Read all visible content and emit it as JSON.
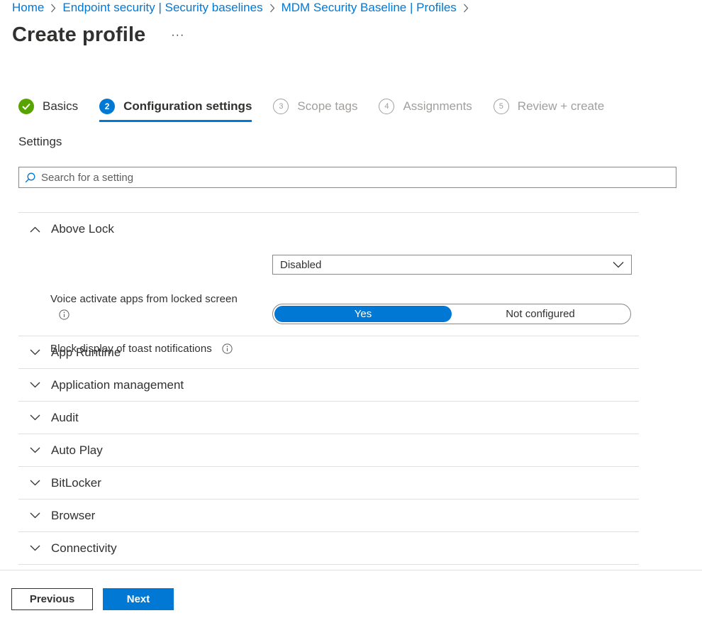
{
  "breadcrumb": {
    "items": [
      "Home",
      "Endpoint security | Security baselines",
      "MDM Security Baseline | Profiles"
    ]
  },
  "page": {
    "title": "Create profile",
    "more": "···"
  },
  "steps": [
    {
      "num": "",
      "label": "Basics",
      "state": "done"
    },
    {
      "num": "2",
      "label": "Configuration settings",
      "state": "active"
    },
    {
      "num": "3",
      "label": "Scope tags",
      "state": "pending"
    },
    {
      "num": "4",
      "label": "Assignments",
      "state": "pending"
    },
    {
      "num": "5",
      "label": "Review + create",
      "state": "pending"
    }
  ],
  "settings": {
    "label": "Settings",
    "search_placeholder": "Search for a setting"
  },
  "above_lock": {
    "title": "Above Lock",
    "voice_label": "Voice activate apps from locked screen",
    "voice_value": "Disabled",
    "toast_label": "Block display of toast notifications",
    "toast_on": "Yes",
    "toast_off": "Not configured"
  },
  "categories": [
    "App Runtime",
    "Application management",
    "Audit",
    "Auto Play",
    "BitLocker",
    "Browser",
    "Connectivity"
  ],
  "footer": {
    "previous": "Previous",
    "next": "Next"
  },
  "colors": {
    "accent": "#0078d4",
    "success": "#57a300",
    "text": "#323130",
    "disabled": "#a19f9d"
  }
}
